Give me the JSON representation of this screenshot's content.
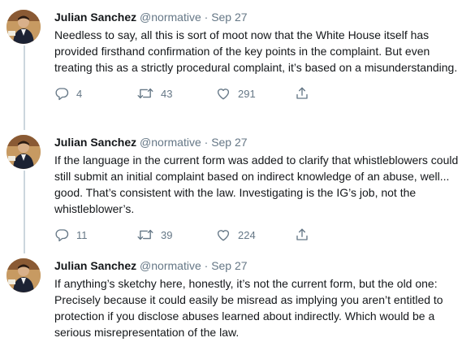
{
  "tweets": [
    {
      "author": "Julian Sanchez",
      "handle": "@normative",
      "separator": "·",
      "date": "Sep 27",
      "text": "Needless to say, all this is sort of moot now that the White House itself has provided firsthand confirmation of the key points in the complaint. But even treating this as a strictly procedural complaint, it’s based on a misunderstanding.",
      "replies": "4",
      "retweets": "43",
      "likes": "291"
    },
    {
      "author": "Julian Sanchez",
      "handle": "@normative",
      "separator": "·",
      "date": "Sep 27",
      "text": "If the language in the current form was added to clarify that whistleblowers could still submit an initial complaint based on indirect knowledge of an abuse, well... good. That’s consistent with the law. Investigating is the IG’s job, not the whistleblower’s.",
      "replies": "11",
      "retweets": "39",
      "likes": "224"
    },
    {
      "author": "Julian Sanchez",
      "handle": "@normative",
      "separator": "·",
      "date": "Sep 27",
      "text": "If anything’s sketchy here, honestly, it’s not the current form, but the old one: Precisely because it could easily be misread as implying you aren’t entitled to protection if you disclose abuses learned about indirectly. Which would be a serious misrepresentation of the law."
    }
  ],
  "icons": {
    "reply": "reply-icon",
    "retweet": "retweet-icon",
    "like": "heart-icon",
    "share": "share-icon"
  },
  "colors": {
    "text": "#14171a",
    "secondary": "#657786",
    "thread_line": "#ccd6dd"
  }
}
